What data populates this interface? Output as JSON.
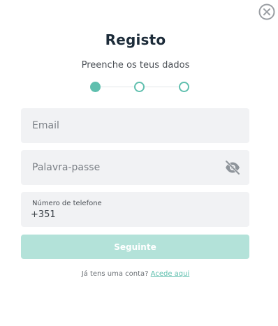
{
  "dialog": {
    "title": "Registo",
    "subtitle": "Preenche os teus dados",
    "steps": {
      "total": 3,
      "current": 1
    }
  },
  "form": {
    "email": {
      "placeholder": "Email",
      "value": ""
    },
    "password": {
      "placeholder": "Palavra-passe",
      "value": "",
      "toggle_icon": "eye-off-icon"
    },
    "phone": {
      "label": "Número de telefone",
      "value": "+351"
    },
    "submit_label": "Seguinte"
  },
  "footer": {
    "prompt": "Já tens uma conta?",
    "link_label": "Acede aqui"
  },
  "colors": {
    "accent": "#5fbfae",
    "button_disabled": "#b3e2d9",
    "field_bg": "#f1f2f4",
    "title": "#1c2b39"
  }
}
